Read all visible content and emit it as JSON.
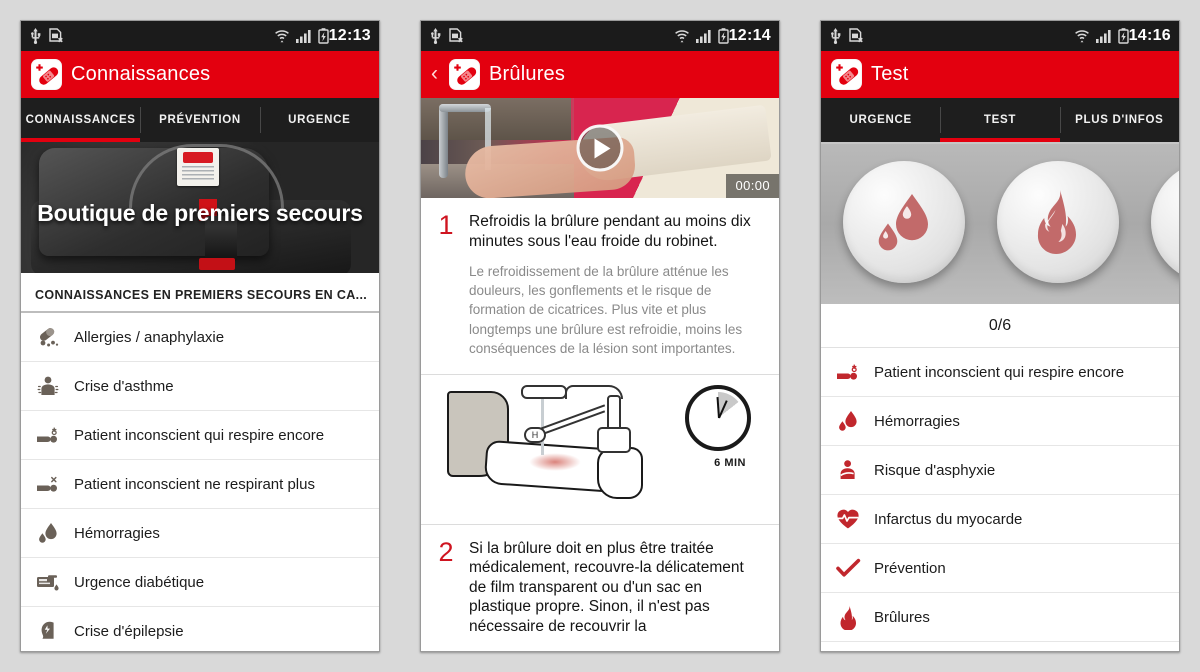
{
  "meta": {
    "accent_red": "#e3000f",
    "tab_dark": "#1e1e1e",
    "list_icon_gray": "#6a6158",
    "list_icon_red": "#c1272d",
    "page_background": "#d9d9d9"
  },
  "panel1": {
    "statusbar": {
      "time": "12:13",
      "icons": [
        "usb-icon",
        "no-sim-card-icon",
        "wifi-icon",
        "signal-bars-icon",
        "battery-charging-icon"
      ]
    },
    "appbar": {
      "title": "Connaissances",
      "logo_icon": "bandage-plaster-app-icon",
      "has_back": false
    },
    "tabs": [
      {
        "label": "CONNAISSANCES",
        "active": true
      },
      {
        "label": "PRÉVENTION",
        "active": false
      },
      {
        "label": "URGENCE",
        "active": false
      }
    ],
    "hero": {
      "title": "Boutique de premiers secours"
    },
    "section_header": "CONNAISSANCES EN PREMIERS SECOURS EN CA...",
    "items": [
      {
        "label": "Allergies / anaphylaxie",
        "icon": "pills-allergy-icon"
      },
      {
        "label": "Crise d'asthme",
        "icon": "asthma-person-icon"
      },
      {
        "label": "Patient inconscient qui respire encore",
        "icon": "unconscious-breathing-icon"
      },
      {
        "label": "Patient inconscient ne respirant plus",
        "icon": "unconscious-not-breathing-icon"
      },
      {
        "label": "Hémorragies",
        "icon": "blood-drop-icon"
      },
      {
        "label": "Urgence diabétique",
        "icon": "glucose-meter-icon"
      },
      {
        "label": "Crise d'épilepsie",
        "icon": "epilepsy-head-icon"
      }
    ]
  },
  "panel2": {
    "statusbar": {
      "time": "12:14"
    },
    "appbar": {
      "title": "Brûlures",
      "logo_icon": "bandage-plaster-app-icon",
      "back_icon": "chevron-left-icon",
      "has_back": true
    },
    "video": {
      "timestamp": "00:00",
      "play_icon": "play-button-icon"
    },
    "steps": [
      {
        "number": "1",
        "title": "Refroidis la brûlure pendant au moins dix minutes sous l'eau froide du robinet.",
        "description": "Le refroidissement de la brûlure atténue les douleurs, les gonflements et le risque de formation de cicatrices. Plus vite et plus longtemps une brûlure est refroidie, moins les conséquences de la lésion sont importantes."
      },
      {
        "number": "2",
        "title": "Si la brûlure doit en plus être traitée médicalement, recouvre-la délicatement de film transparent ou d'un sac en plastique propre. Sinon, il n'est pas nécessaire de recouvrir la"
      }
    ],
    "illustration": {
      "clock_label": "6 MIN",
      "tap_knob_label": "H",
      "alt": "arm-under-running-tap-illustration"
    }
  },
  "panel3": {
    "statusbar": {
      "time": "14:16"
    },
    "appbar": {
      "title": "Test",
      "logo_icon": "bandage-plaster-app-icon",
      "has_back": false
    },
    "tabs": [
      {
        "label": "URGENCE",
        "active": false
      },
      {
        "label": "TEST",
        "active": true
      },
      {
        "label": "PLUS D'INFOS",
        "active": false
      }
    ],
    "carousel": [
      {
        "icon": "blood-drop-badge-icon"
      },
      {
        "icon": "flame-badge-icon"
      },
      {
        "icon": "partial-badge-icon"
      }
    ],
    "counter": "0/6",
    "items": [
      {
        "label": "Patient inconscient qui respire encore",
        "icon": "unconscious-breathing-icon"
      },
      {
        "label": "Hémorragies",
        "icon": "blood-drop-icon"
      },
      {
        "label": "Risque d'asphyxie",
        "icon": "asphyxia-person-icon"
      },
      {
        "label": "Infarctus du myocarde",
        "icon": "heart-pulse-icon"
      },
      {
        "label": "Prévention",
        "icon": "checkmark-icon"
      },
      {
        "label": "Brûlures",
        "icon": "flame-icon"
      }
    ]
  }
}
